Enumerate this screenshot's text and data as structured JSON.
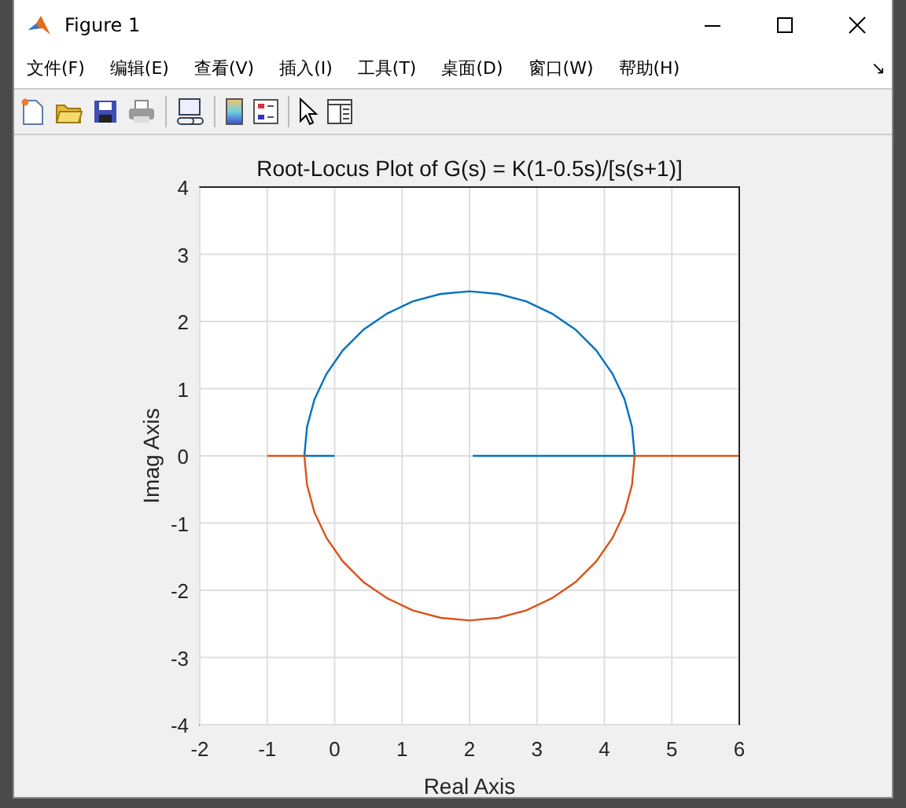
{
  "window": {
    "title": "Figure 1"
  },
  "menu": [
    {
      "label": "文件(F)"
    },
    {
      "label": "编辑(E)"
    },
    {
      "label": "查看(V)"
    },
    {
      "label": "插入(I)"
    },
    {
      "label": "工具(T)"
    },
    {
      "label": "桌面(D)"
    },
    {
      "label": "窗口(W)"
    },
    {
      "label": "帮助(H)"
    }
  ],
  "menu_overflow": "↘",
  "toolbar": [
    {
      "kind": "new"
    },
    {
      "kind": "open"
    },
    {
      "kind": "save"
    },
    {
      "kind": "print"
    },
    {
      "kind": "sep"
    },
    {
      "kind": "link"
    },
    {
      "kind": "sep"
    },
    {
      "kind": "colorbar"
    },
    {
      "kind": "legend"
    },
    {
      "kind": "sep"
    },
    {
      "kind": "pointer"
    },
    {
      "kind": "inspector"
    }
  ],
  "plot": {
    "chart_data": {
      "type": "line",
      "title": "Root-Locus Plot of G(s) = K(1-0.5s)/[s(s+1)]",
      "xlabel": "Real Axis",
      "ylabel": "Imag Axis",
      "xlim": [
        -2,
        6
      ],
      "ylim": [
        -4,
        4
      ],
      "xticks": [
        -2,
        -1,
        0,
        1,
        2,
        3,
        4,
        5,
        6
      ],
      "yticks": [
        -4,
        -3,
        -2,
        -1,
        0,
        1,
        2,
        3,
        4
      ],
      "grid": true,
      "series": [
        {
          "color": "#0072bd",
          "x": [
            0,
            -0.45,
            -0.41,
            -0.3,
            -0.12,
            0.12,
            0.43,
            0.78,
            1.16,
            1.57,
            2,
            2.43,
            2.84,
            3.22,
            3.57,
            3.88,
            4.12,
            4.3,
            4.41,
            4.45,
            2.05
          ],
          "values": [
            0,
            0,
            0.43,
            0.84,
            1.22,
            1.57,
            1.88,
            2.12,
            2.3,
            2.41,
            2.45,
            2.41,
            2.3,
            2.12,
            1.88,
            1.57,
            1.22,
            0.84,
            0.43,
            0,
            0
          ]
        },
        {
          "color": "#d95319",
          "x": [
            -1,
            -0.45,
            -0.41,
            -0.3,
            -0.12,
            0.12,
            0.43,
            0.78,
            1.16,
            1.57,
            2,
            2.43,
            2.84,
            3.22,
            3.57,
            3.88,
            4.12,
            4.3,
            4.41,
            4.45,
            6
          ],
          "values": [
            0,
            0,
            -0.43,
            -0.84,
            -1.22,
            -1.57,
            -1.88,
            -2.12,
            -2.3,
            -2.41,
            -2.45,
            -2.41,
            -2.3,
            -2.12,
            -1.88,
            -1.57,
            -1.22,
            -0.84,
            -0.43,
            0,
            0
          ]
        }
      ]
    }
  }
}
